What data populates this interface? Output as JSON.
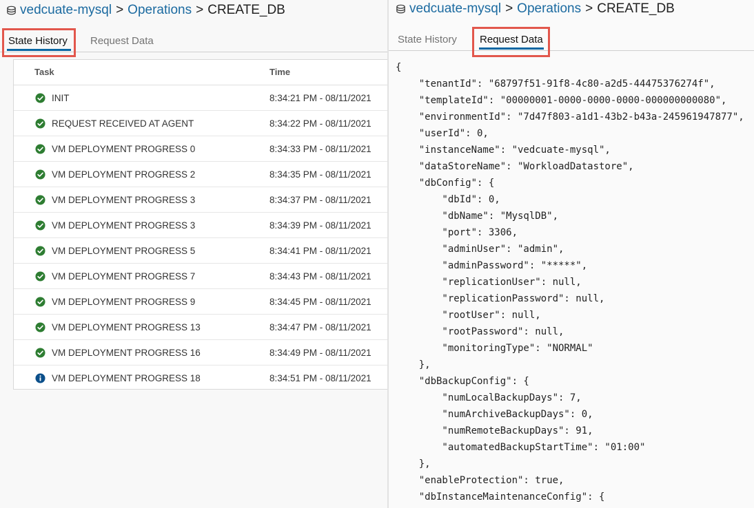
{
  "breadcrumb": {
    "instance": "vedcuate-mysql",
    "operations": "Operations",
    "current": "CREATE_DB",
    "separator": ">",
    "icon": "database-icon"
  },
  "left_tabs": [
    {
      "label": "State History",
      "active": true
    },
    {
      "label": "Request Data",
      "active": false
    }
  ],
  "right_tabs": [
    {
      "label": "State History",
      "active": false
    },
    {
      "label": "Request Data",
      "active": true
    }
  ],
  "table": {
    "headers": {
      "task": "Task",
      "time": "Time"
    },
    "rows": [
      {
        "task": "INIT",
        "time": "8:34:21 PM - 08/11/2021",
        "status": "success"
      },
      {
        "task": "REQUEST RECEIVED AT AGENT",
        "time": "8:34:22 PM - 08/11/2021",
        "status": "success"
      },
      {
        "task": "VM DEPLOYMENT PROGRESS 0",
        "time": "8:34:33 PM - 08/11/2021",
        "status": "success"
      },
      {
        "task": "VM DEPLOYMENT PROGRESS 2",
        "time": "8:34:35 PM - 08/11/2021",
        "status": "success"
      },
      {
        "task": "VM DEPLOYMENT PROGRESS 3",
        "time": "8:34:37 PM - 08/11/2021",
        "status": "success"
      },
      {
        "task": "VM DEPLOYMENT PROGRESS 3",
        "time": "8:34:39 PM - 08/11/2021",
        "status": "success"
      },
      {
        "task": "VM DEPLOYMENT PROGRESS 5",
        "time": "8:34:41 PM - 08/11/2021",
        "status": "success"
      },
      {
        "task": "VM DEPLOYMENT PROGRESS 7",
        "time": "8:34:43 PM - 08/11/2021",
        "status": "success"
      },
      {
        "task": "VM DEPLOYMENT PROGRESS 9",
        "time": "8:34:45 PM - 08/11/2021",
        "status": "success"
      },
      {
        "task": "VM DEPLOYMENT PROGRESS 13",
        "time": "8:34:47 PM - 08/11/2021",
        "status": "success"
      },
      {
        "task": "VM DEPLOYMENT PROGRESS 16",
        "time": "8:34:49 PM - 08/11/2021",
        "status": "success"
      },
      {
        "task": "VM DEPLOYMENT PROGRESS 18",
        "time": "8:34:51 PM - 08/11/2021",
        "status": "info"
      }
    ]
  },
  "request_json": "{\n    \"tenantId\": \"68797f51-91f8-4c80-a2d5-44475376274f\",\n    \"templateId\": \"00000001-0000-0000-0000-000000000080\",\n    \"environmentId\": \"7d47f803-a1d1-43b2-b43a-245961947877\",\n    \"userId\": 0,\n    \"instanceName\": \"vedcuate-mysql\",\n    \"dataStoreName\": \"WorkloadDatastore\",\n    \"dbConfig\": {\n        \"dbId\": 0,\n        \"dbName\": \"MysqlDB\",\n        \"port\": 3306,\n        \"adminUser\": \"admin\",\n        \"adminPassword\": \"*****\",\n        \"replicationUser\": null,\n        \"replicationPassword\": null,\n        \"rootUser\": null,\n        \"rootPassword\": null,\n        \"monitoringType\": \"NORMAL\"\n    },\n    \"dbBackupConfig\": {\n        \"numLocalBackupDays\": 7,\n        \"numArchiveBackupDays\": 0,\n        \"numRemoteBackupDays\": 91,\n        \"automatedBackupStartTime\": \"01:00\"\n    },\n    \"enableProtection\": true,\n    \"dbInstanceMaintenanceConfig\": {",
  "colors": {
    "link": "#1b6aa0",
    "tab_underline": "#0a67a3",
    "highlight": "#e2574c",
    "success": "#2e7d32",
    "info": "#0b4f8a"
  }
}
